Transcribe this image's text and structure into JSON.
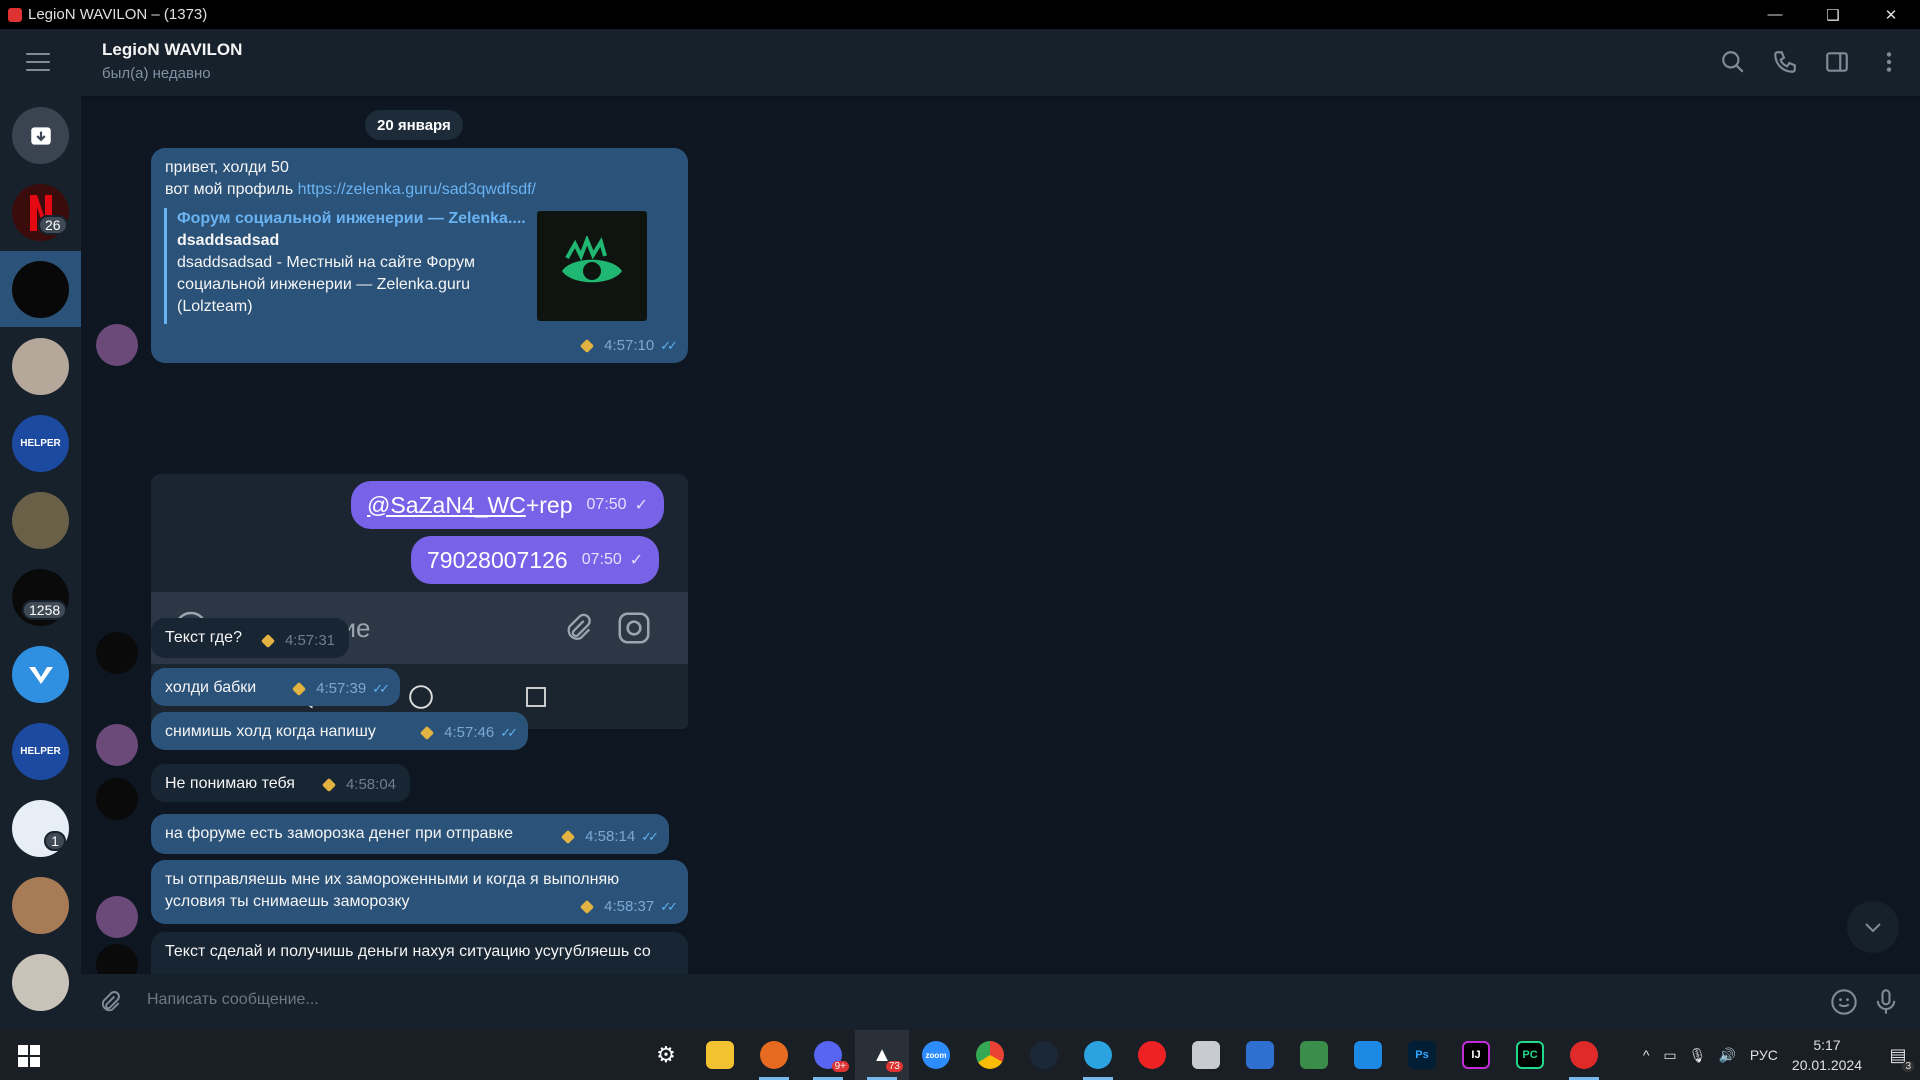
{
  "window": {
    "title": "LegioN WAVILON – (1373)"
  },
  "header": {
    "chat_name": "LegioN WAVILON",
    "status": "был(а) недавно"
  },
  "rail": {
    "badges": [
      "26",
      "1258",
      "1"
    ]
  },
  "messages": {
    "date": "20 января",
    "m1": {
      "line1": "привет, холди 50",
      "line2": "вот мой профиль ",
      "link": "https://zelenka.guru/sad3qwdfsdf/",
      "preview_title": "Форум социальной инженерии — Zelenka....",
      "preview_site": "dsaddsadsad",
      "preview_desc": "dsaddsadsad - Местный на сайте Форум социальной инженерии — Zelenka.guru (Lolzteam)",
      "time": "4:57:10"
    },
    "screenshot": {
      "mention": "@SaZaN4_WC",
      "mention_rest": " +rep",
      "time1": "07:50",
      "phone": "79028007126",
      "time2": "07:50",
      "input_placeholder": "Сообщение"
    },
    "m2": {
      "text": "Текст где?",
      "time": "4:57:31"
    },
    "m3": {
      "text": "холди бабки",
      "time": "4:57:39"
    },
    "m4": {
      "text": "снимишь холд когда напишу",
      "time": "4:57:46"
    },
    "m5": {
      "text": "Не понимаю тебя",
      "time": "4:58:04"
    },
    "m6": {
      "text": "на форуме есть заморозка денег при отправке",
      "time": "4:58:14"
    },
    "m7": {
      "text": "ты отправляешь мне их замороженными и когда я выполняю условия ты снимаешь заморозку",
      "time": "4:58:37"
    },
    "m8": {
      "text": "Текст сделай и получишь деньги нахуя ситуацию усугубляешь со"
    }
  },
  "composer": {
    "placeholder": "Написать сообщение..."
  },
  "taskbar": {
    "lang": "РУС",
    "time": "5:17",
    "date": "20.01.2024",
    "notif_count": "3",
    "discord_badge": "9+",
    "app_badge": "73"
  }
}
